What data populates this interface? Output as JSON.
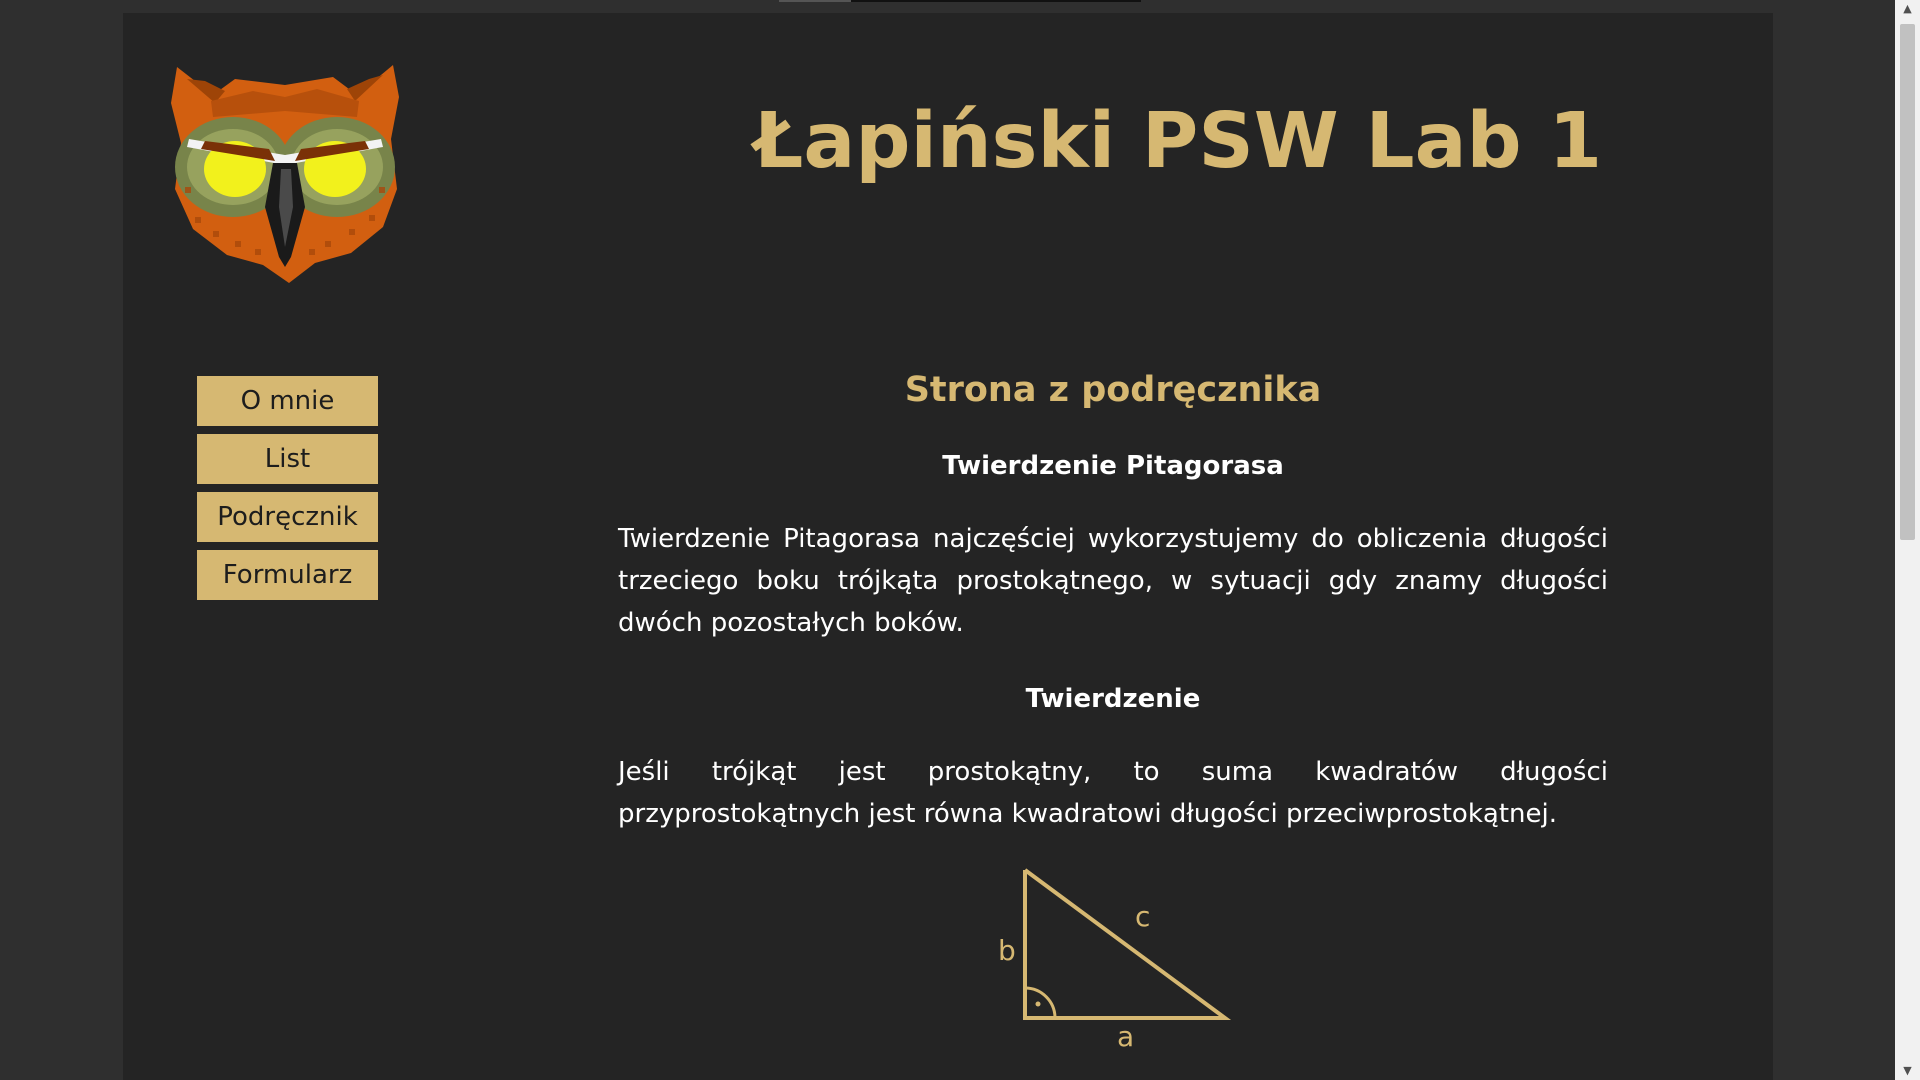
{
  "header": {
    "title": "Łapiński PSW Lab 1",
    "logo_icon": "owl-head-icon"
  },
  "nav": {
    "items": [
      {
        "label": "O mnie"
      },
      {
        "label": "List"
      },
      {
        "label": "Podręcznik"
      },
      {
        "label": "Formularz"
      }
    ]
  },
  "main": {
    "section_title": "Strona z podręcznika",
    "subtitle_1": "Twierdzenie Pitagorasa",
    "paragraph_1": "Twierdzenie Pitagorasa najczęściej wykorzystujemy do obliczenia długości trzeciego boku trójkąta prostokątnego, w sytuacji gdy znamy długości dwóch pozostałych boków.",
    "subtitle_2": "Twierdzenie",
    "paragraph_2": "Jeśli trójkąt jest prostokątny, to suma kwadratów długości przyprostokątnych jest równa kwadratowi długości przeciwprostokątnej.",
    "figure": {
      "label_a": "a",
      "label_b": "b",
      "label_c": "c"
    }
  },
  "colors": {
    "accent": "#d6b872",
    "page_background": "#242424",
    "outer_background": "#2f2f2f",
    "text": "#ffffff"
  }
}
